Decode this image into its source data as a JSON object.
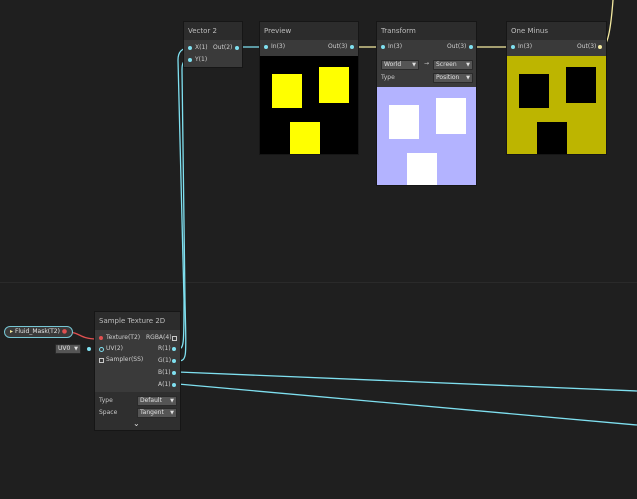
{
  "vector2": {
    "title": "Vector 2",
    "in_x": "X(1)",
    "in_y": "Y(1)",
    "out": "Out(2)"
  },
  "preview": {
    "title": "Preview",
    "in": "In(3)",
    "out": "Out(3)"
  },
  "transform": {
    "title": "Transform",
    "in": "In(3)",
    "out": "Out(3)",
    "from": "World",
    "arrow": "→",
    "to": "Screen",
    "type_label": "Type",
    "type_value": "Position"
  },
  "one_minus": {
    "title": "One Minus",
    "in": "In(3)",
    "out": "Out(3)"
  },
  "sample": {
    "title": "Sample Texture 2D",
    "in_texture": "Texture(T2)",
    "in_uv": "UV(2)",
    "in_sampler": "Sampler(SS)",
    "out_rgba": "RGBA(4)",
    "out_r": "R(1)",
    "out_g": "G(1)",
    "out_b": "B(1)",
    "out_a": "A(1)",
    "type_label": "Type",
    "type_value": "Default",
    "space_label": "Space",
    "space_value": "Tangent"
  },
  "property": {
    "label": "Fluid_Mask(T2)"
  },
  "uv_dropdown": {
    "value": "UV0"
  },
  "colors": {
    "wire_cyan": "#7fe0f0",
    "wire_yellow": "#f4eaa0",
    "wire_red": "#e05050",
    "preview_yellow": "#ffff00",
    "transform_bg": "#b3b3ff",
    "oneminus_bg": "#bdb500"
  }
}
